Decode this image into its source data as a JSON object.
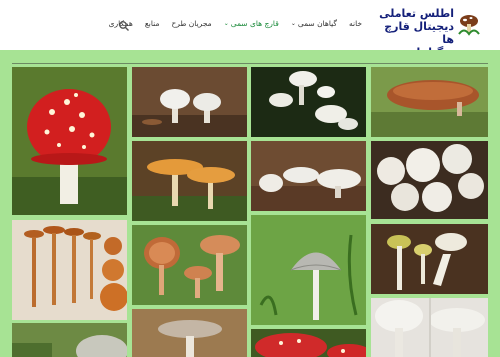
{
  "site": {
    "title_line1": "اطلس تعاملی",
    "title_line2": "دیجیتال قارچ ها",
    "title_line3": "و گیاهان سمی"
  },
  "nav": {
    "items": [
      {
        "label": "خانه"
      },
      {
        "label": "گیاهان سمی",
        "has_caret": true
      },
      {
        "label": "قارچ های سمی",
        "has_caret": true,
        "active": true
      },
      {
        "label": "مجریان طرح"
      },
      {
        "label": "منابع"
      },
      {
        "label": "همکاری"
      }
    ],
    "search_icon": "search-icon"
  },
  "colors": {
    "band": "#a7e394",
    "active_nav": "#1a8a3a",
    "title": "#14207a"
  },
  "gallery": {
    "tiles": [
      {
        "name": "amanita-muscaria"
      },
      {
        "name": "white-caps-forest"
      },
      {
        "name": "white-mushrooms-dark"
      },
      {
        "name": "brown-bracket"
      },
      {
        "name": "orange-caps-moss"
      },
      {
        "name": "white-caps-leaves"
      },
      {
        "name": "puffballs"
      },
      {
        "name": "tan-mushrooms-specimens"
      },
      {
        "name": "orange-gills"
      },
      {
        "name": "grey-cone-cap"
      },
      {
        "name": "yellow-white-stems"
      },
      {
        "name": "grey-cap-bottom"
      },
      {
        "name": "white-cap-bottom"
      },
      {
        "name": "red-caps-bottom"
      },
      {
        "name": "white-large-bottom"
      }
    ]
  }
}
